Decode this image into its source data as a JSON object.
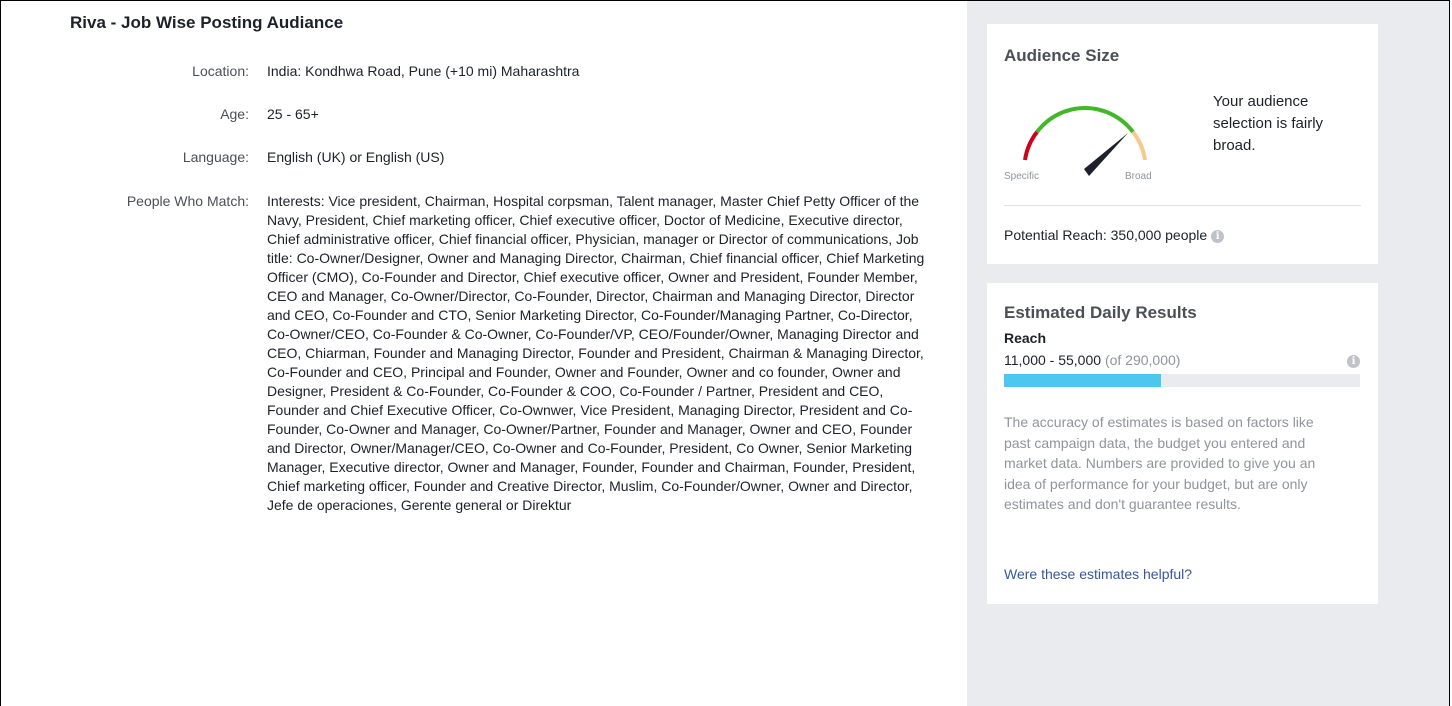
{
  "title": "Riva - Job Wise Posting Audiance",
  "location": {
    "label": "Location:",
    "value": "India: Kondhwa Road, Pune (+10 mi) Maharashtra"
  },
  "age": {
    "label": "Age:",
    "value": "25 - 65+"
  },
  "language": {
    "label": "Language:",
    "value": "English (UK) or English (US)"
  },
  "people_who_match": {
    "label": "People Who Match:",
    "value": "Interests: Vice president, Chairman, Hospital corpsman, Talent manager, Master Chief Petty Officer of the Navy, President, Chief marketing officer, Chief executive officer, Doctor of Medicine, Executive director, Chief administrative officer, Chief financial officer, Physician, manager or Director of communications, Job title: Co-Owner/Designer, Owner and Managing Director, Chairman, Chief financial officer, Chief Marketing Officer (CMO), Co-Founder and Director, Chief executive officer, Owner and President, Founder Member, CEO and Manager, Co-Owner/Director, Co-Founder, Director, Chairman and Managing Director, Director and CEO, Co-Founder and CTO, Senior Marketing Director, Co-Founder/Managing Partner, Co-Director, Co-Owner/CEO, Co-Founder & Co-Owner, Co-Founder/VP, CEO/Founder/Owner, Managing Director and CEO, Chiarman, Founder and Managing Director, Founder and President, Chairman & Managing Director, Co-Founder and CEO, Principal and Founder, Owner and Founder, Owner and co founder, Owner and Designer, President & Co-Founder, Co-Founder & COO, Co-Founder / Partner, President and CEO, Founder and Chief Executive Officer, Co-Ownwer, Vice President, Managing Director, President and Co-Founder, Co-Owner and Manager, Co-Owner/Partner, Founder and Manager, Owner and CEO, Founder and Director, Owner/Manager/CEO, Co-Owner and Co-Founder, President, Co Owner, Senior Marketing Manager, Executive director, Owner and Manager, Founder, Founder and Chairman, Founder, President, Chief marketing officer, Founder and Creative Director, Muslim, Co-Founder/Owner, Owner and Director, Jefe de operaciones, Gerente general or Direktur"
  },
  "audience_size": {
    "heading": "Audience Size",
    "gauge_left_label": "Specific",
    "gauge_right_label": "Broad",
    "description": "Your audience selection is fairly broad.",
    "potential_reach": "Potential Reach: 350,000 people",
    "colors": {
      "red": "#d0021b",
      "green": "#42b72a",
      "orange": "#f7c98b",
      "needle": "#1d2129"
    }
  },
  "daily_results": {
    "heading": "Estimated Daily Results",
    "reach_label": "Reach",
    "reach_range": "11,000 - 55,000",
    "reach_of": "(of 290,000)",
    "reach_bar_fraction": 0.44,
    "bar_color": "#4cc7f0",
    "disclaimer": "The accuracy of estimates is based on factors like past campaign data, the budget you entered and market data. Numbers are provided to give you an idea of performance for your budget, but are only estimates and don't guarantee results.",
    "helpful_link": "Were these estimates helpful?"
  },
  "icons": {
    "info": "info-icon"
  }
}
